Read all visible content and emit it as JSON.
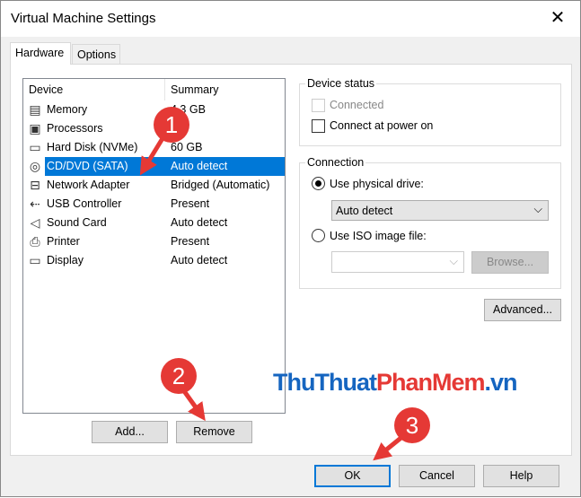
{
  "window": {
    "title": "Virtual Machine Settings",
    "close": "✕"
  },
  "tabs": [
    {
      "label": "Hardware"
    },
    {
      "label": "Options"
    }
  ],
  "device_list": {
    "columns": [
      "Device",
      "Summary"
    ],
    "rows": [
      {
        "icon": "memory-icon",
        "glyph": "▤",
        "device": "Memory",
        "summary": "4.3 GB"
      },
      {
        "icon": "processor-icon",
        "glyph": "▣",
        "device": "Processors",
        "summary": ""
      },
      {
        "icon": "hard-disk-icon",
        "glyph": "▭",
        "device": "Hard Disk (NVMe)",
        "summary": "60 GB"
      },
      {
        "icon": "cd-dvd-icon",
        "glyph": "◎",
        "device": "CD/DVD (SATA)",
        "summary": "Auto detect",
        "selected": true
      },
      {
        "icon": "network-adapter-icon",
        "glyph": "⊟",
        "device": "Network Adapter",
        "summary": "Bridged (Automatic)"
      },
      {
        "icon": "usb-icon",
        "glyph": "⇠",
        "device": "USB Controller",
        "summary": "Present"
      },
      {
        "icon": "sound-icon",
        "glyph": "◁",
        "device": "Sound Card",
        "summary": "Auto detect"
      },
      {
        "icon": "printer-icon",
        "glyph": "⎙",
        "device": "Printer",
        "summary": "Present"
      },
      {
        "icon": "display-icon",
        "glyph": "▭",
        "device": "Display",
        "summary": "Auto detect"
      }
    ]
  },
  "list_buttons": {
    "add": "Add...",
    "remove": "Remove"
  },
  "device_status": {
    "label": "Device status",
    "connected": "Connected",
    "connect_power_on": "Connect at power on",
    "connected_checked": false,
    "power_on_checked": false
  },
  "connection": {
    "label": "Connection",
    "physical": "Use physical drive:",
    "physical_selected": true,
    "drive_value": "Auto detect",
    "iso": "Use ISO image file:",
    "iso_value": "",
    "browse": "Browse..."
  },
  "advanced": "Advanced...",
  "footer": {
    "ok": "OK",
    "cancel": "Cancel",
    "help": "Help"
  },
  "annotations": [
    "1",
    "2",
    "3"
  ],
  "watermark": {
    "part1": "ThuThuat",
    "part2": "PhanMem",
    "part3": ".vn",
    "colors": [
      "#1565c0",
      "#e53935",
      "#1565c0"
    ]
  }
}
